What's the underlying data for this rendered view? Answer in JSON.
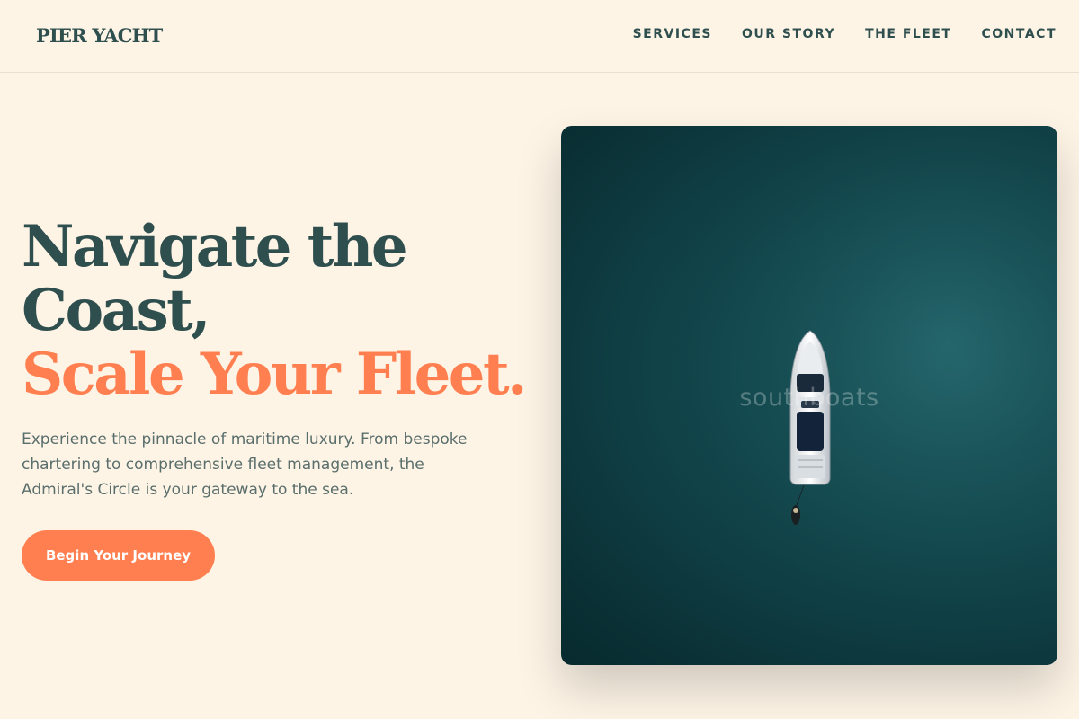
{
  "brand": {
    "name": "PIER YACHT"
  },
  "nav": {
    "items": [
      {
        "label": "SERVICES"
      },
      {
        "label": "OUR STORY"
      },
      {
        "label": "THE FLEET"
      },
      {
        "label": "CONTACT"
      }
    ]
  },
  "hero": {
    "headline_line1": "Navigate the",
    "headline_line2": "Coast,",
    "headline_accent": "Scale Your Fleet.",
    "description": "Experience the pinnacle of maritime luxury. From bespoke chartering to comprehensive fleet management, the Admiral's Circle is your gateway to the sea.",
    "cta_label": "Begin Your Journey",
    "image_watermark": "southboats"
  },
  "colors": {
    "background": "#fdf4e6",
    "primary": "#2f4f4f",
    "accent": "#ff7f50",
    "text_muted": "#5a6e6c",
    "sea": "#134a50"
  },
  "icons": {
    "hero_image": "yacht-aerial-photo"
  }
}
